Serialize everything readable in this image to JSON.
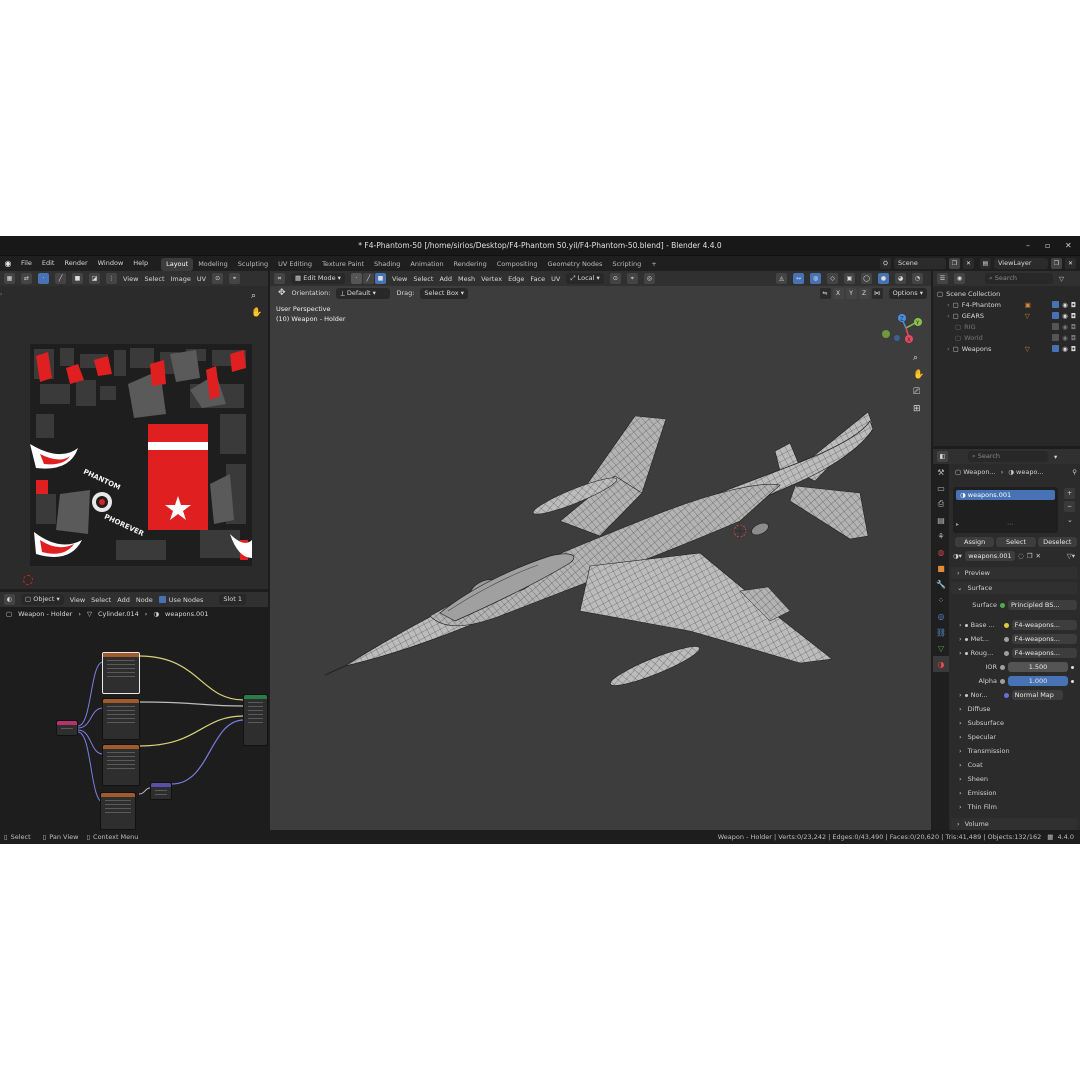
{
  "app": {
    "title": "* F4-Phantom-50 [/home/sirios/Desktop/F4-Phantom 50.yil/F4-Phantom-50.blend] - Blender 4.4.0",
    "version": "4.4.0"
  },
  "topbar": {
    "menus": [
      "File",
      "Edit",
      "Render",
      "Window",
      "Help"
    ],
    "workspaces": [
      "Layout",
      "Modeling",
      "Sculpting",
      "UV Editing",
      "Texture Paint",
      "Shading",
      "Animation",
      "Rendering",
      "Compositing",
      "Geometry Nodes",
      "Scripting"
    ],
    "active_workspace": "Layout",
    "scene": "Scene",
    "view_layer": "ViewLayer"
  },
  "uv_editor": {
    "menus": [
      "View",
      "Select",
      "Image",
      "UV"
    ],
    "texture_text": [
      "PHANTOM",
      "PHOREVER"
    ]
  },
  "viewport": {
    "mode": "Edit Mode",
    "menus": [
      "View",
      "Select",
      "Add",
      "Mesh",
      "Vertex",
      "Edge",
      "Face",
      "UV"
    ],
    "transform": "Local",
    "orientation_label": "Orientation:",
    "orientation_value": "Default",
    "drag_label": "Drag:",
    "drag_value": "Select Box",
    "axes": [
      "X",
      "Y",
      "Z"
    ],
    "options": "Options",
    "overlay_line1": "User Perspective",
    "overlay_line2": "(10) Weapon - Holder",
    "gizmo": {
      "x": "X",
      "y": "Y",
      "z": "Z"
    }
  },
  "node_editor": {
    "object_mode": "Object",
    "menus": [
      "View",
      "Select",
      "Add",
      "Node"
    ],
    "use_nodes": "Use Nodes",
    "slot": "Slot 1",
    "breadcrumb": [
      "Weapon - Holder",
      "Cylinder.014",
      "weapons.001"
    ]
  },
  "outliner": {
    "search_placeholder": "Search",
    "root": "Scene Collection",
    "items": [
      {
        "label": "F4-Phantom",
        "enabled": true
      },
      {
        "label": "GEARS",
        "enabled": true
      },
      {
        "label": "RIG",
        "enabled": false
      },
      {
        "label": "World",
        "enabled": false
      },
      {
        "label": "Weapons",
        "enabled": true
      }
    ]
  },
  "properties": {
    "search_placeholder": "Search",
    "breadcrumb_object": "Weapon...",
    "breadcrumb_material": "weapo...",
    "slot": "weapons.001",
    "assign": "Assign",
    "select": "Select",
    "deselect": "Deselect",
    "material": "weapons.001",
    "preview": "Preview",
    "surface_panel": "Surface",
    "surface_label": "Surface",
    "surface_value": "Principled BS...",
    "inputs": [
      {
        "label": "Base ...",
        "value": "F4-weapons..."
      },
      {
        "label": "Met...",
        "value": "F4-weapons..."
      },
      {
        "label": "Roug...",
        "value": "F4-weapons..."
      }
    ],
    "ior_label": "IOR",
    "ior_value": "1.500",
    "alpha_label": "Alpha",
    "alpha_value": "1.000",
    "normal_label": "Nor...",
    "normal_value": "Normal Map",
    "subpanels": [
      "Diffuse",
      "Subsurface",
      "Specular",
      "Transmission",
      "Coat",
      "Sheen",
      "Emission",
      "Thin Film"
    ],
    "volume": "Volume"
  },
  "statusbar": {
    "select": "Select",
    "pan": "Pan View",
    "context": "Context Menu",
    "stats": "Weapon - Holder | Verts:0/23,242 | Edges:0/43,490 | Faces:0/20,620 | Tris:41,489 | Objects:132/162",
    "version": "4.4.0"
  },
  "colors": {
    "accent": "#4772b3",
    "texture_red": "#e02020",
    "mesh": "#b7b7b7",
    "viewport_bg": "#3d3d3d"
  }
}
